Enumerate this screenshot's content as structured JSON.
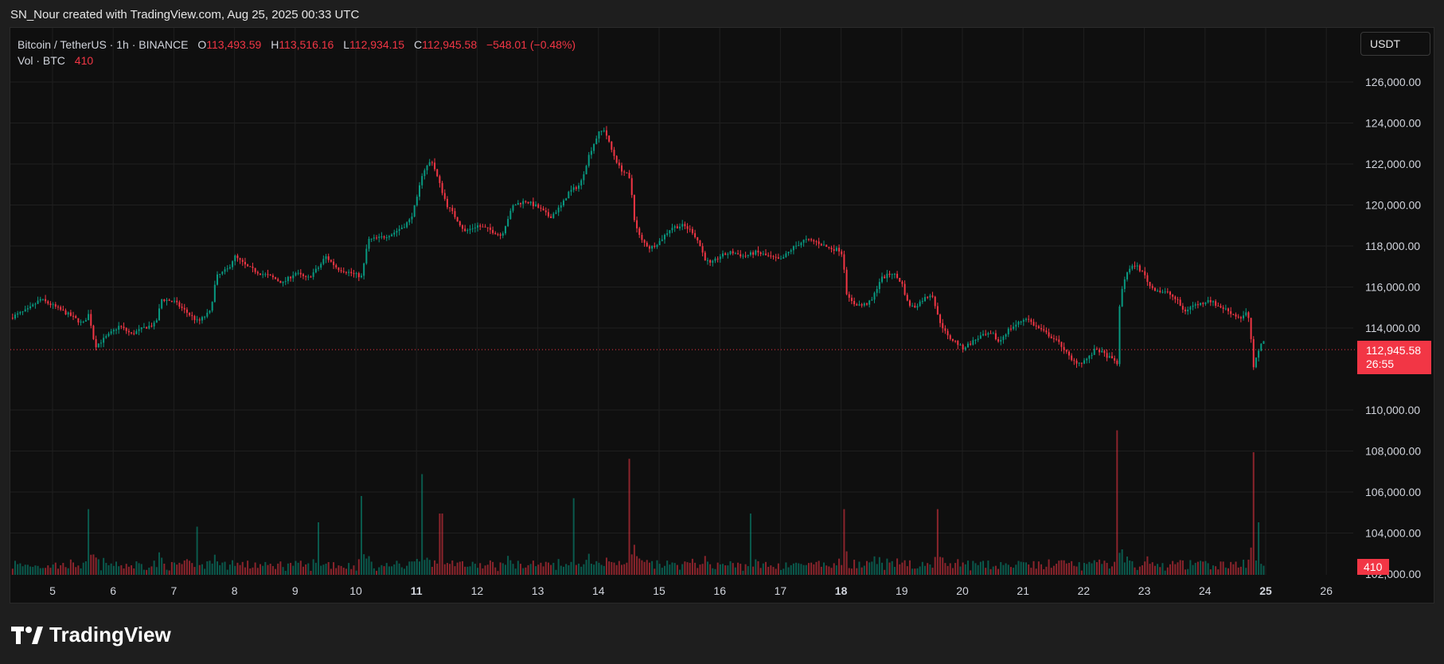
{
  "header": {
    "caption": "SN_Nour created with TradingView.com, Aug 25, 2025 00:33 UTC"
  },
  "legend": {
    "symbol": "Bitcoin / TetherUS · 1h · BINANCE",
    "o_label": "O",
    "o_value": "113,493.59",
    "h_label": "H",
    "h_value": "113,516.16",
    "l_label": "L",
    "l_value": "112,934.15",
    "c_label": "C",
    "c_value": "112,945.58",
    "change": "−548.01 (−0.48%)",
    "vol_label": "Vol · BTC",
    "vol_value": "410"
  },
  "currency_button": "USDT",
  "last_price_tag": {
    "price": "112,945.58",
    "countdown": "26:55"
  },
  "volume_tag": "410",
  "brand": {
    "name": "TradingView"
  },
  "colors": {
    "up": "#089981",
    "down": "#f23645",
    "grid": "#1f1f1f",
    "background": "#0f0f0f"
  },
  "chart_data": {
    "type": "candlestick",
    "interval": "1h",
    "ylim": [
      109500,
      127600
    ],
    "yticks": [
      {
        "value": 126000,
        "label": "126,000.00"
      },
      {
        "value": 124000,
        "label": "124,000.00"
      },
      {
        "value": 122000,
        "label": "122,000.00"
      },
      {
        "value": 120000,
        "label": "120,000.00"
      },
      {
        "value": 118000,
        "label": "118,000.00"
      },
      {
        "value": 116000,
        "label": "116,000.00"
      },
      {
        "value": 114000,
        "label": "114,000.00"
      },
      {
        "value": 110000,
        "label": "110,000.00"
      },
      {
        "value": 108000,
        "label": "108,000.00"
      },
      {
        "value": 106000,
        "label": "106,000.00"
      },
      {
        "value": 104000,
        "label": "104,000.00"
      },
      {
        "value": 102000,
        "label": "102,000.00"
      }
    ],
    "xticks": [
      {
        "day": 5,
        "label": "5",
        "bold": false
      },
      {
        "day": 6,
        "label": "6",
        "bold": false
      },
      {
        "day": 7,
        "label": "7",
        "bold": false
      },
      {
        "day": 8,
        "label": "8",
        "bold": false
      },
      {
        "day": 9,
        "label": "9",
        "bold": false
      },
      {
        "day": 10,
        "label": "10",
        "bold": false
      },
      {
        "day": 11,
        "label": "11",
        "bold": true
      },
      {
        "day": 12,
        "label": "12",
        "bold": false
      },
      {
        "day": 13,
        "label": "13",
        "bold": false
      },
      {
        "day": 14,
        "label": "14",
        "bold": false
      },
      {
        "day": 15,
        "label": "15",
        "bold": false
      },
      {
        "day": 16,
        "label": "16",
        "bold": false
      },
      {
        "day": 17,
        "label": "17",
        "bold": false
      },
      {
        "day": 18,
        "label": "18",
        "bold": true
      },
      {
        "day": 19,
        "label": "19",
        "bold": false
      },
      {
        "day": 20,
        "label": "20",
        "bold": false
      },
      {
        "day": 21,
        "label": "21",
        "bold": false
      },
      {
        "day": 22,
        "label": "22",
        "bold": false
      },
      {
        "day": 23,
        "label": "23",
        "bold": false
      },
      {
        "day": 24,
        "label": "24",
        "bold": false
      },
      {
        "day": 25,
        "label": "25",
        "bold": true
      },
      {
        "day": 26,
        "label": "26",
        "bold": false
      }
    ],
    "last_price": 112945.58,
    "price_path": [
      [
        4.3,
        114500
      ],
      [
        4.6,
        114900
      ],
      [
        4.8,
        115400
      ],
      [
        5.0,
        115100
      ],
      [
        5.3,
        114600
      ],
      [
        5.5,
        114200
      ],
      [
        5.6,
        114700
      ],
      [
        5.7,
        113100
      ],
      [
        5.9,
        113600
      ],
      [
        6.1,
        114100
      ],
      [
        6.3,
        113700
      ],
      [
        6.5,
        114000
      ],
      [
        6.7,
        114200
      ],
      [
        6.8,
        115400
      ],
      [
        7.0,
        115300
      ],
      [
        7.2,
        114800
      ],
      [
        7.4,
        114300
      ],
      [
        7.6,
        114800
      ],
      [
        7.7,
        116500
      ],
      [
        7.9,
        116900
      ],
      [
        8.0,
        117500
      ],
      [
        8.2,
        117000
      ],
      [
        8.4,
        116700
      ],
      [
        8.6,
        116500
      ],
      [
        8.8,
        116200
      ],
      [
        9.0,
        116700
      ],
      [
        9.2,
        116400
      ],
      [
        9.4,
        117000
      ],
      [
        9.5,
        117500
      ],
      [
        9.7,
        116900
      ],
      [
        9.9,
        116700
      ],
      [
        10.1,
        116500
      ],
      [
        10.2,
        118300
      ],
      [
        10.4,
        118400
      ],
      [
        10.6,
        118600
      ],
      [
        10.8,
        119000
      ],
      [
        10.9,
        119300
      ],
      [
        11.0,
        120200
      ],
      [
        11.1,
        121600
      ],
      [
        11.25,
        122200
      ],
      [
        11.35,
        121300
      ],
      [
        11.5,
        120000
      ],
      [
        11.6,
        119600
      ],
      [
        11.8,
        118700
      ],
      [
        12.0,
        119000
      ],
      [
        12.2,
        118800
      ],
      [
        12.4,
        118500
      ],
      [
        12.5,
        119300
      ],
      [
        12.6,
        120000
      ],
      [
        12.8,
        120200
      ],
      [
        13.0,
        119900
      ],
      [
        13.2,
        119400
      ],
      [
        13.4,
        120000
      ],
      [
        13.5,
        120600
      ],
      [
        13.7,
        121000
      ],
      [
        13.85,
        122500
      ],
      [
        14.0,
        123500
      ],
      [
        14.1,
        123700
      ],
      [
        14.2,
        122800
      ],
      [
        14.35,
        121800
      ],
      [
        14.5,
        121400
      ],
      [
        14.55,
        120500
      ],
      [
        14.6,
        119100
      ],
      [
        14.7,
        118300
      ],
      [
        14.85,
        117900
      ],
      [
        15.0,
        118200
      ],
      [
        15.2,
        118900
      ],
      [
        15.4,
        119000
      ],
      [
        15.55,
        118700
      ],
      [
        15.65,
        118200
      ],
      [
        15.75,
        117400
      ],
      [
        15.85,
        117100
      ],
      [
        16.0,
        117500
      ],
      [
        16.2,
        117700
      ],
      [
        16.4,
        117500
      ],
      [
        16.6,
        117700
      ],
      [
        16.8,
        117500
      ],
      [
        17.0,
        117300
      ],
      [
        17.2,
        117900
      ],
      [
        17.4,
        118300
      ],
      [
        17.6,
        118200
      ],
      [
        17.8,
        117900
      ],
      [
        18.0,
        117800
      ],
      [
        18.05,
        116900
      ],
      [
        18.1,
        115500
      ],
      [
        18.2,
        115200
      ],
      [
        18.35,
        115100
      ],
      [
        18.5,
        115300
      ],
      [
        18.65,
        116400
      ],
      [
        18.85,
        116700
      ],
      [
        19.0,
        116200
      ],
      [
        19.1,
        115200
      ],
      [
        19.2,
        115000
      ],
      [
        19.35,
        115400
      ],
      [
        19.5,
        115700
      ],
      [
        19.6,
        114500
      ],
      [
        19.75,
        113600
      ],
      [
        19.9,
        113300
      ],
      [
        20.0,
        113000
      ],
      [
        20.15,
        113300
      ],
      [
        20.3,
        113600
      ],
      [
        20.5,
        113700
      ],
      [
        20.6,
        113300
      ],
      [
        20.75,
        113900
      ],
      [
        20.9,
        114200
      ],
      [
        21.05,
        114500
      ],
      [
        21.2,
        114100
      ],
      [
        21.35,
        113800
      ],
      [
        21.5,
        113500
      ],
      [
        21.65,
        113100
      ],
      [
        21.8,
        112400
      ],
      [
        21.95,
        112300
      ],
      [
        22.1,
        112600
      ],
      [
        22.2,
        113000
      ],
      [
        22.3,
        112800
      ],
      [
        22.45,
        112500
      ],
      [
        22.55,
        112300
      ],
      [
        22.6,
        115500
      ],
      [
        22.7,
        116700
      ],
      [
        22.85,
        117100
      ],
      [
        23.0,
        116600
      ],
      [
        23.1,
        116000
      ],
      [
        23.25,
        115800
      ],
      [
        23.4,
        115700
      ],
      [
        23.55,
        115300
      ],
      [
        23.65,
        114800
      ],
      [
        23.8,
        115100
      ],
      [
        23.95,
        115200
      ],
      [
        24.05,
        115400
      ],
      [
        24.2,
        115100
      ],
      [
        24.35,
        114900
      ],
      [
        24.5,
        114600
      ],
      [
        24.6,
        114500
      ],
      [
        24.7,
        114800
      ],
      [
        24.77,
        113200
      ],
      [
        24.8,
        112000
      ],
      [
        24.85,
        112600
      ],
      [
        24.9,
        113100
      ],
      [
        24.95,
        113500
      ],
      [
        25.0,
        112946
      ]
    ],
    "volume_spikes": [
      [
        5.6,
        150
      ],
      [
        7.4,
        110
      ],
      [
        9.4,
        120
      ],
      [
        10.1,
        180
      ],
      [
        11.1,
        230
      ],
      [
        11.4,
        140
      ],
      [
        13.6,
        175
      ],
      [
        14.5,
        265
      ],
      [
        16.5,
        140
      ],
      [
        18.05,
        150
      ],
      [
        19.6,
        150
      ],
      [
        22.55,
        330
      ],
      [
        24.8,
        280
      ],
      [
        24.9,
        120
      ]
    ]
  }
}
